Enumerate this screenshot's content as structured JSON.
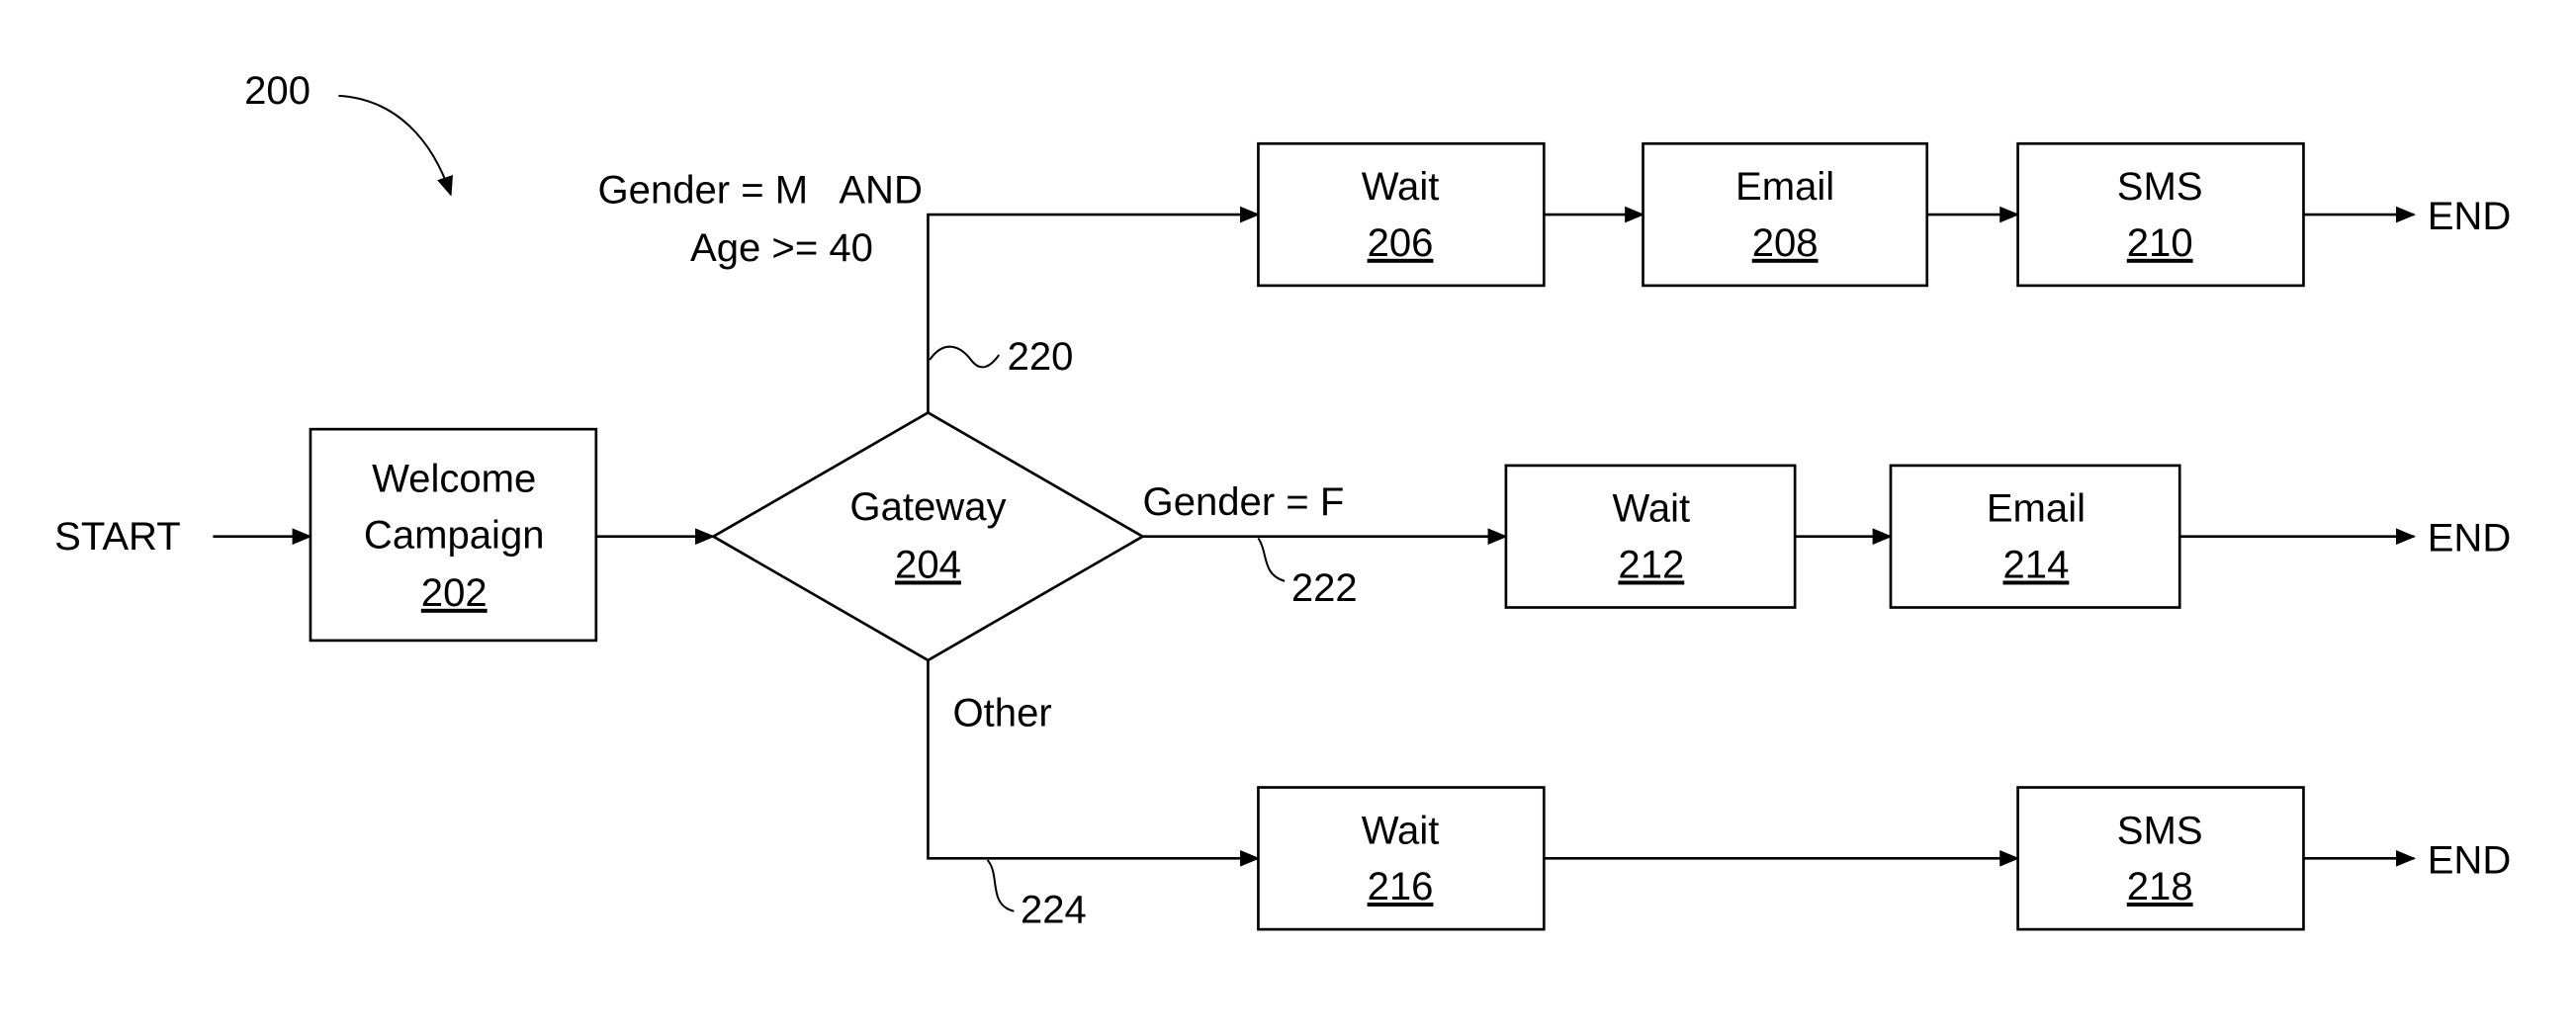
{
  "figure": {
    "ref": "200"
  },
  "start_label": "START",
  "end_label": "END",
  "nodes": {
    "welcome": {
      "line1": "Welcome",
      "line2": "Campaign",
      "ref": "202"
    },
    "gateway": {
      "label": "Gateway",
      "ref": "204"
    },
    "wait206": {
      "label": "Wait",
      "ref": "206"
    },
    "email208": {
      "label": "Email",
      "ref": "208"
    },
    "sms210": {
      "label": "SMS",
      "ref": "210"
    },
    "wait212": {
      "label": "Wait",
      "ref": "212"
    },
    "email214": {
      "label": "Email",
      "ref": "214"
    },
    "wait216": {
      "label": "Wait",
      "ref": "216"
    },
    "sms218": {
      "label": "SMS",
      "ref": "218"
    }
  },
  "branches": {
    "top": {
      "condition_line1": "Gender = M   AND",
      "condition_line2": "Age >= 40",
      "ref": "220"
    },
    "middle": {
      "condition": "Gender = F",
      "ref": "222"
    },
    "bottom": {
      "condition": "Other",
      "ref": "224"
    }
  }
}
